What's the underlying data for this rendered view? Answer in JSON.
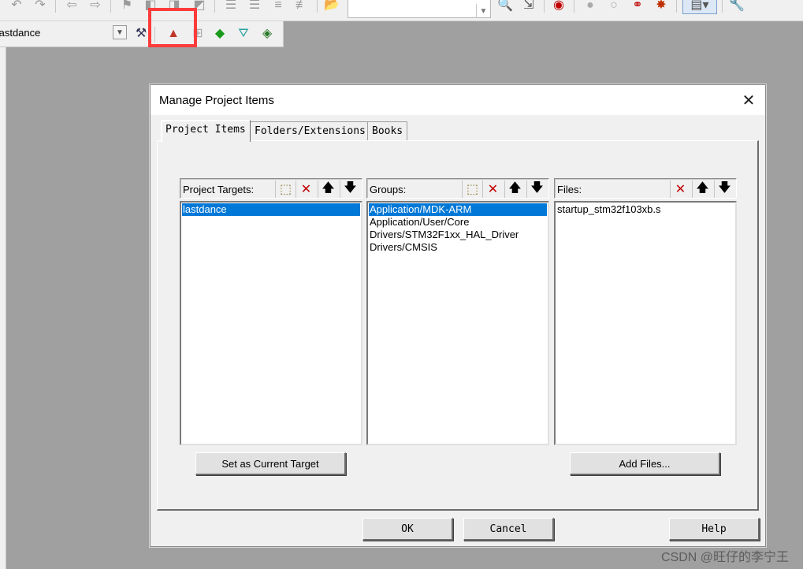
{
  "toolbar": {
    "target_name": "tastdance",
    "icons": [
      "undo-icon",
      "redo-icon",
      "nav-back-icon",
      "nav-forward-icon",
      "bookmark-icon"
    ]
  },
  "dialog": {
    "title": "Manage Project Items",
    "close_symbol": "✕",
    "tabs": [
      {
        "label": "Project Items",
        "active": true
      },
      {
        "label": "Folders/Extensions",
        "active": false
      },
      {
        "label": "Books",
        "active": false
      }
    ],
    "targets": {
      "header": "Project Targets:",
      "items": [
        {
          "name": "lastdance",
          "selected": true
        }
      ]
    },
    "groups": {
      "header": "Groups:",
      "items": [
        {
          "name": "Application/MDK-ARM",
          "selected": true
        },
        {
          "name": "Application/User/Core",
          "selected": false
        },
        {
          "name": "Drivers/STM32F1xx_HAL_Driver",
          "selected": false
        },
        {
          "name": "Drivers/CMSIS",
          "selected": false
        }
      ]
    },
    "files": {
      "header": "Files:",
      "items": [
        {
          "name": "startup_stm32f103xb.s",
          "selected": false
        }
      ]
    },
    "buttons": {
      "set_target": "Set as Current Target",
      "add_files": "Add Files...",
      "ok": "OK",
      "cancel": "Cancel",
      "help": "Help"
    }
  },
  "watermark": "CSDN @旺仔的李宁王",
  "colors": {
    "selection": "#0078d7",
    "highlight": "#ff3b3b",
    "delete": "#c00000"
  }
}
